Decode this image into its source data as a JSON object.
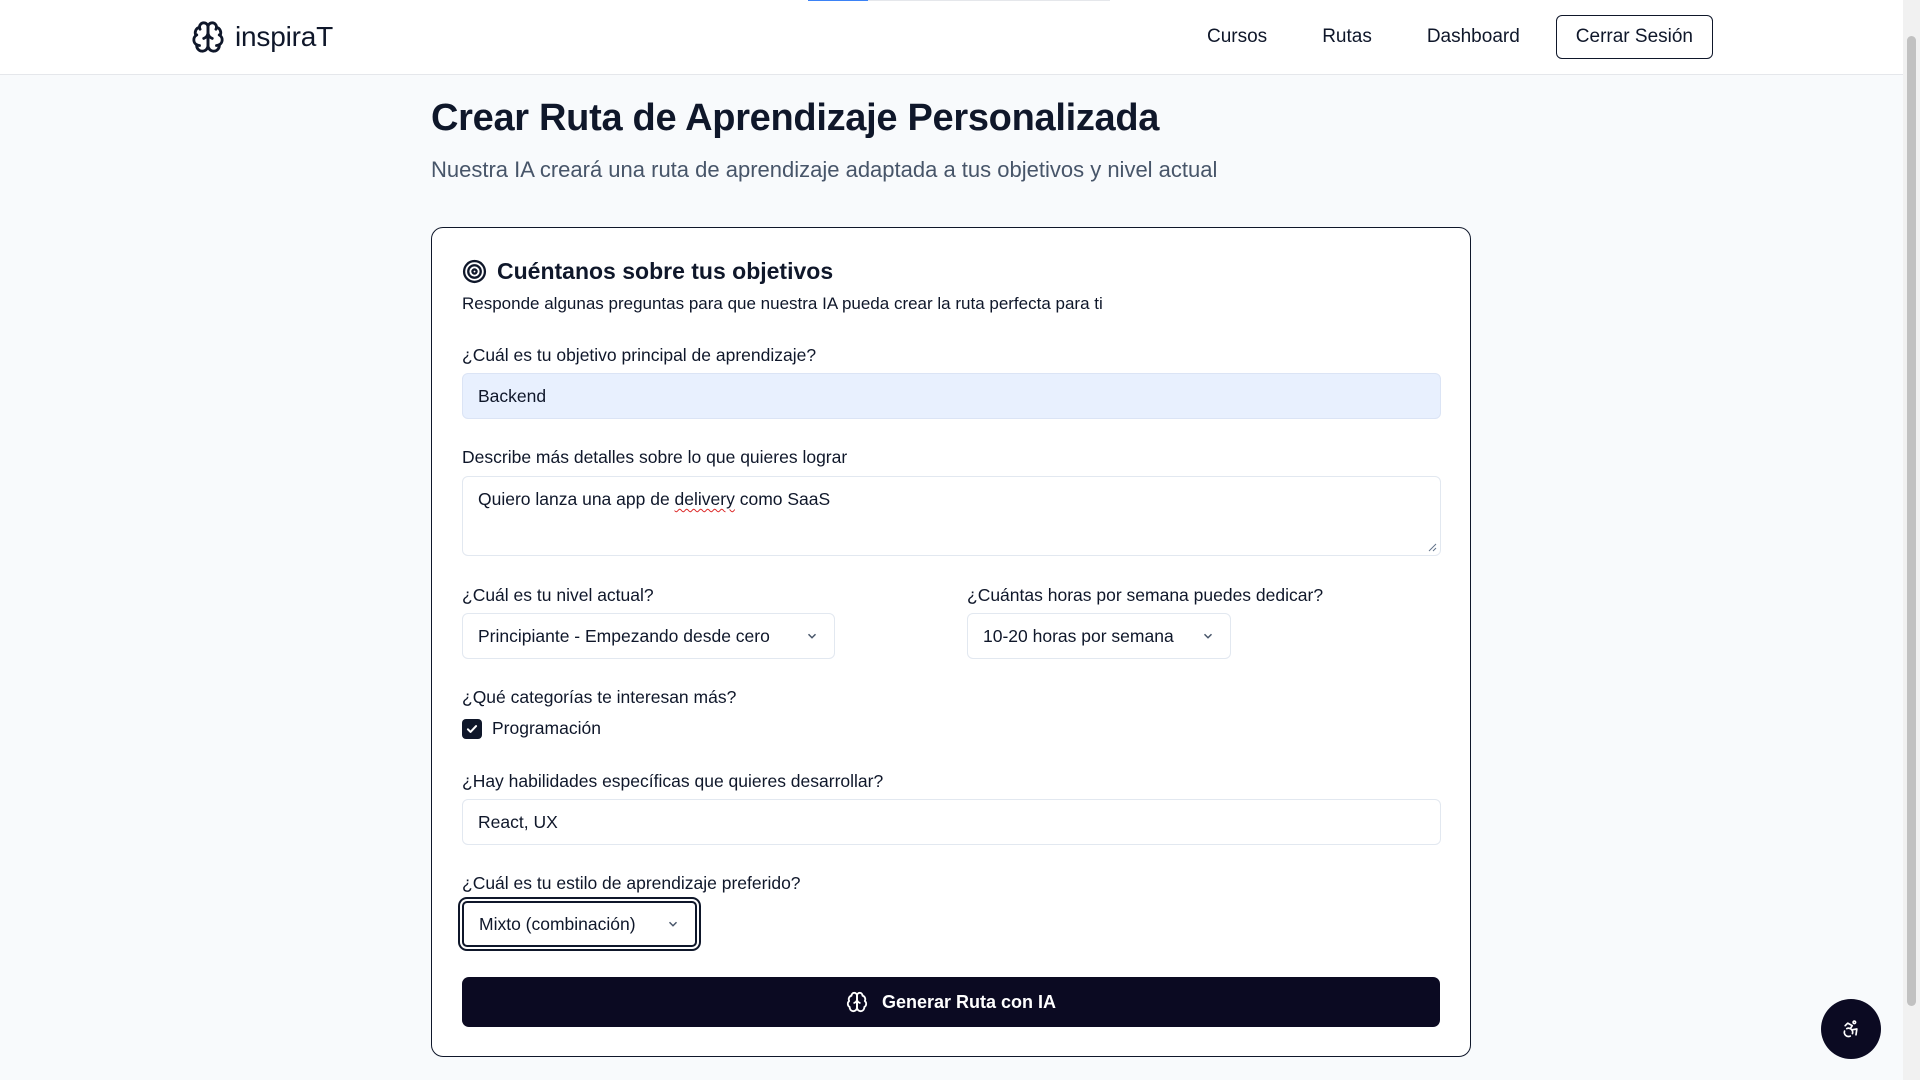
{
  "header": {
    "logo_text": "inspiraT",
    "logo_icon": "brain-icon",
    "nav": [
      "Cursos",
      "Rutas",
      "Dashboard"
    ],
    "logout_label": "Cerrar Sesión"
  },
  "page": {
    "title": "Crear Ruta de Aprendizaje Personalizada",
    "subtitle": "Nuestra IA creará una ruta de aprendizaje adaptada a tus objetivos y nivel actual"
  },
  "card": {
    "icon": "target-icon",
    "title": "Cuéntanos sobre tus objetivos",
    "description": "Responde algunas preguntas para que nuestra IA pueda crear la ruta perfecta para ti"
  },
  "form": {
    "goal": {
      "label": "¿Cuál es tu objetivo principal de aprendizaje?",
      "value": "Backend"
    },
    "details": {
      "label": "Describe más detalles sobre lo que quieres lograar",
      "value_before": "Quiero lanza una app de ",
      "value_misspelled": "delivery",
      "value_after": " como SaaS"
    },
    "level": {
      "label": "¿Cuál es tu nivel actual?",
      "value": "Principiante - Empezando desde cero"
    },
    "hours": {
      "label": "¿Cuántas horas por semana puedes dedicar?",
      "value": "10-20 horas por semana"
    },
    "categories": {
      "label": "¿Qué categorías te interesan más?",
      "options": [
        {
          "label": "Programación",
          "checked": true
        }
      ]
    },
    "skills": {
      "label": "¿Hay habilidades específicas que quieres desarrollar?",
      "value": "React, UX"
    },
    "style": {
      "label": "¿Cuál es tu estilo de aprendizaje preferido?",
      "value": "Mixto (combinación)"
    },
    "submit_label": "Generar Ruta con IA"
  },
  "accessibility_icon": "accessibility-icon",
  "colors": {
    "primary": "#0b0a22",
    "text": "#0f172a",
    "muted": "#475569",
    "autofill": "#e8f0fe",
    "background": "#f8fafc"
  }
}
